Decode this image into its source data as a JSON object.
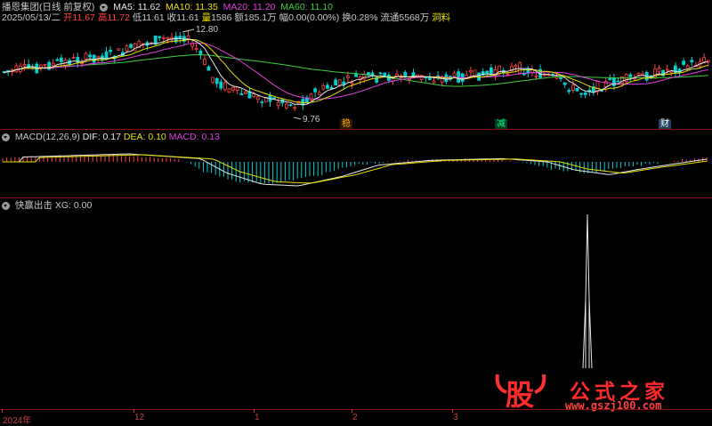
{
  "header": {
    "stock_title": "播恩集团(日线 前复权)",
    "ma5": "MA5: 11.62",
    "ma10": "MA10: 11.35",
    "ma20": "MA20: 11.20",
    "ma60": "MA60: 11.10",
    "date": "2025/05/13/二",
    "open_label": "开",
    "open_val": "11.67",
    "high_label": "高",
    "high_val": "11.72",
    "low_label": "低",
    "low_val": "11.61",
    "close_label": "收",
    "close_val": "11.61",
    "vol_label": "量",
    "vol_val": "1586",
    "amount_label": "额",
    "amount_val": "185.1万",
    "range_label": "幅",
    "range_val": "0.00(0.00%)",
    "turnover_label": "换",
    "turnover_val": "0.28%",
    "float_label": "流通",
    "float_val": "5568万",
    "extra": "洞料"
  },
  "price_chart": {
    "high_mark": "12.80",
    "low_mark": "9.76",
    "tags": [
      "稳",
      "减",
      "财"
    ]
  },
  "macd": {
    "title": "MACD(12,26,9)",
    "dif": "DIF: 0.17",
    "dea": "DEA: 0.10",
    "macd": "MACD: 0.13"
  },
  "indicator": {
    "title": "快赢出击",
    "xg": "XG: 0.00"
  },
  "xaxis": {
    "labels": [
      "2024年",
      "12",
      "1",
      "2",
      "3"
    ]
  },
  "watermark": {
    "brand": "公式之家",
    "char": "股",
    "url": "www.gszj100.com"
  },
  "colors": {
    "up": "#ff4040",
    "down": "#00d0d0",
    "ma5": "#e8e8e8",
    "ma10": "#e8e000",
    "ma20": "#e040e0",
    "ma60": "#40d040"
  }
}
